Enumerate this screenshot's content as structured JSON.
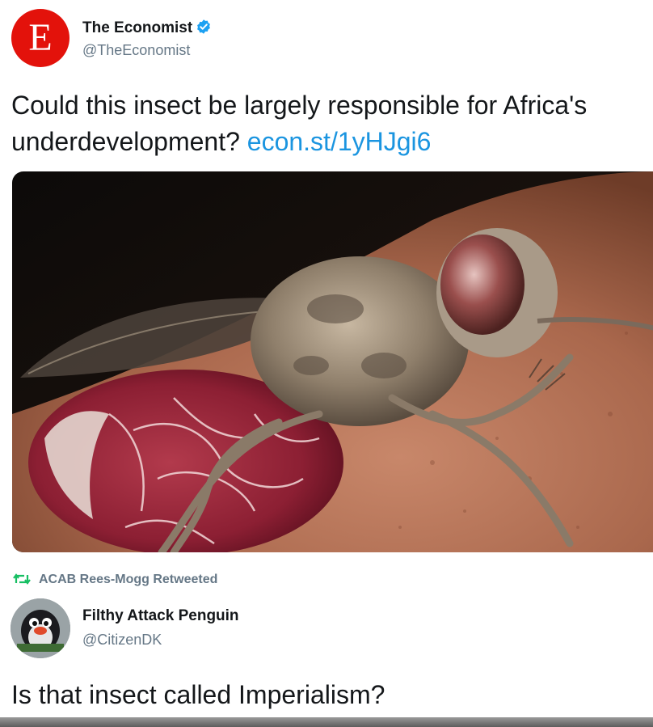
{
  "original_tweet": {
    "avatar_letter": "E",
    "author_name": "The Economist",
    "verified": true,
    "handle": "@TheEconomist",
    "text": "Could this insect be largely responsible for Africa's underdevelopment?",
    "text_line1": "Could this insect be largely responsible for Africa's",
    "text_line2": "underdevelopment?",
    "link": "econ.st/1yHJgi6"
  },
  "retweet": {
    "retweeted_by": "ACAB Rees-Mogg Retweeted",
    "author_name": "Filthy Attack Penguin",
    "handle": "@CitizenDK",
    "text": "Is that insect called Imperialism?"
  },
  "colors": {
    "economist_red": "#e3120b",
    "link_blue": "#1b95e0",
    "muted_gray": "#657786",
    "retweet_green": "#17bf63"
  },
  "icons": [
    "verified-badge-icon",
    "retweet-icon"
  ]
}
